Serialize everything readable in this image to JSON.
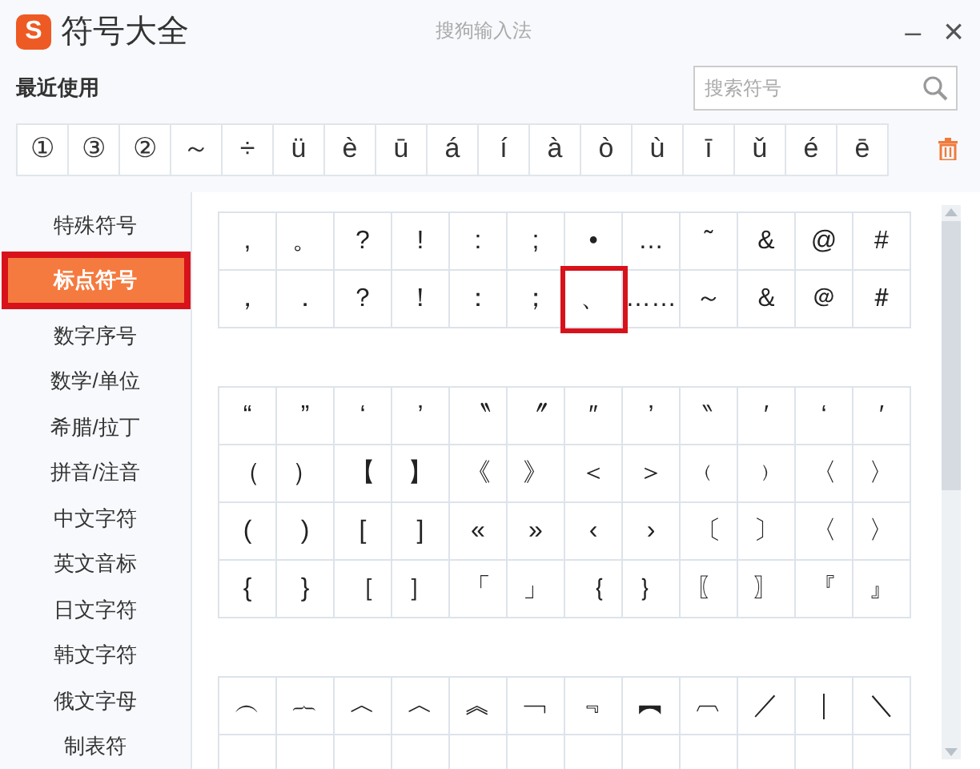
{
  "window": {
    "logo_letter": "S",
    "title": "符号大全",
    "app_name": "搜狗输入法",
    "minimize": "–",
    "close": "×"
  },
  "recent": {
    "label": "最近使用",
    "symbols": [
      "①",
      "③",
      "②",
      "～",
      "÷",
      "ü",
      "è",
      "ū",
      "á",
      "í",
      "à",
      "ò",
      "ù",
      "ī",
      "ǔ",
      "é",
      "ē"
    ]
  },
  "search": {
    "placeholder": "搜索符号"
  },
  "sidebar": {
    "items": [
      {
        "label": "特殊符号",
        "selected": false,
        "marked": false
      },
      {
        "label": "标点符号",
        "selected": true,
        "marked": true
      },
      {
        "label": "数字序号",
        "selected": false,
        "marked": false
      },
      {
        "label": "数学/单位",
        "selected": false,
        "marked": false
      },
      {
        "label": "希腊/拉丁",
        "selected": false,
        "marked": false
      },
      {
        "label": "拼音/注音",
        "selected": false,
        "marked": false
      },
      {
        "label": "中文字符",
        "selected": false,
        "marked": false
      },
      {
        "label": "英文音标",
        "selected": false,
        "marked": false
      },
      {
        "label": "日文字符",
        "selected": false,
        "marked": false
      },
      {
        "label": "韩文字符",
        "selected": false,
        "marked": false
      },
      {
        "label": "俄文字母",
        "selected": false,
        "marked": false
      },
      {
        "label": "制表符",
        "selected": false,
        "marked": false
      }
    ]
  },
  "symbol_tables": [
    {
      "rows": [
        [
          {
            "text": ",",
            "marked": false
          },
          {
            "text": "。",
            "marked": false
          },
          {
            "text": "?",
            "marked": false
          },
          {
            "text": "!",
            "marked": false
          },
          {
            "text": ":",
            "marked": false
          },
          {
            "text": ";",
            "marked": false
          },
          {
            "text": "•",
            "marked": false
          },
          {
            "text": "…",
            "marked": false
          },
          {
            "text": "˜",
            "marked": false
          },
          {
            "text": "&",
            "marked": false
          },
          {
            "text": "@",
            "marked": false
          },
          {
            "text": "#",
            "marked": false
          }
        ],
        [
          {
            "text": "，",
            "marked": false
          },
          {
            "text": "．",
            "marked": false
          },
          {
            "text": "？",
            "marked": false
          },
          {
            "text": "！",
            "marked": false
          },
          {
            "text": "：",
            "marked": false
          },
          {
            "text": "；",
            "marked": false
          },
          {
            "text": "、",
            "marked": true
          },
          {
            "text": "……",
            "marked": false
          },
          {
            "text": "～",
            "marked": false
          },
          {
            "text": "＆",
            "marked": false
          },
          {
            "text": "＠",
            "marked": false
          },
          {
            "text": "＃",
            "marked": false
          }
        ]
      ]
    },
    {
      "rows": [
        [
          {
            "text": "“",
            "marked": false
          },
          {
            "text": "”",
            "marked": false
          },
          {
            "text": "‘",
            "marked": false
          },
          {
            "text": "’",
            "marked": false
          },
          {
            "text": "〝",
            "marked": false
          },
          {
            "text": "〞",
            "marked": false
          },
          {
            "text": "″",
            "marked": false
          },
          {
            "text": "’",
            "marked": false
          },
          {
            "text": "‶",
            "marked": false
          },
          {
            "text": "′",
            "marked": false
          },
          {
            "text": "‘",
            "marked": false
          },
          {
            "text": "′",
            "marked": false
          }
        ],
        [
          {
            "text": "（",
            "marked": false
          },
          {
            "text": "）",
            "marked": false
          },
          {
            "text": "【",
            "marked": false
          },
          {
            "text": "】",
            "marked": false
          },
          {
            "text": "《",
            "marked": false
          },
          {
            "text": "》",
            "marked": false
          },
          {
            "text": "＜",
            "marked": false
          },
          {
            "text": "＞",
            "marked": false
          },
          {
            "text": "﹙",
            "marked": false
          },
          {
            "text": "﹚",
            "marked": false
          },
          {
            "text": "〈",
            "marked": false
          },
          {
            "text": "〉",
            "marked": false
          }
        ],
        [
          {
            "text": "(",
            "marked": false
          },
          {
            "text": ")",
            "marked": false
          },
          {
            "text": "[",
            "marked": false
          },
          {
            "text": "]",
            "marked": false
          },
          {
            "text": "«",
            "marked": false
          },
          {
            "text": "»",
            "marked": false
          },
          {
            "text": "‹",
            "marked": false
          },
          {
            "text": "›",
            "marked": false
          },
          {
            "text": "〔",
            "marked": false
          },
          {
            "text": "〕",
            "marked": false
          },
          {
            "text": "〈",
            "marked": false
          },
          {
            "text": "〉",
            "marked": false
          }
        ],
        [
          {
            "text": "{",
            "marked": false
          },
          {
            "text": "}",
            "marked": false
          },
          {
            "text": "［",
            "marked": false
          },
          {
            "text": "］",
            "marked": false
          },
          {
            "text": "「",
            "marked": false
          },
          {
            "text": "」",
            "marked": false
          },
          {
            "text": "｛",
            "marked": false
          },
          {
            "text": "｝",
            "marked": false
          },
          {
            "text": "〖",
            "marked": false
          },
          {
            "text": "〗",
            "marked": false
          },
          {
            "text": "『",
            "marked": false
          },
          {
            "text": "』",
            "marked": false
          }
        ]
      ]
    },
    {
      "rows": [
        [
          {
            "text": "︵",
            "marked": false
          },
          {
            "text": "︷",
            "marked": false
          },
          {
            "text": "︿",
            "marked": false
          },
          {
            "text": "︿",
            "marked": false
          },
          {
            "text": "︽",
            "marked": false
          },
          {
            "text": "﹁",
            "marked": false
          },
          {
            "text": "﹃",
            "marked": false
          },
          {
            "text": "︻",
            "marked": false
          },
          {
            "text": "︹",
            "marked": false
          },
          {
            "text": "／",
            "marked": false
          },
          {
            "text": "｜",
            "marked": false
          },
          {
            "text": "＼",
            "marked": false
          }
        ]
      ]
    }
  ]
}
